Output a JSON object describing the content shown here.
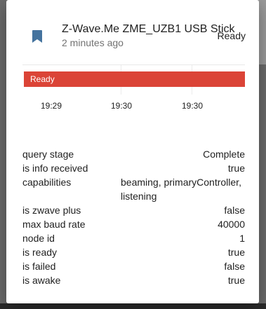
{
  "colors": {
    "accent": "#44739e",
    "state_bar": "#db4437"
  },
  "header": {
    "icon": "bookmark-icon",
    "entity_name": "Z-Wave.Me ZME_UZB1 USB Stick",
    "last_changed": "2 minutes ago",
    "state": "Ready"
  },
  "timeline": {
    "bar_label": "Ready",
    "ticks": [
      "19:29",
      "19:30",
      "19:30"
    ]
  },
  "attributes": [
    {
      "key": "query stage",
      "value": "Complete"
    },
    {
      "key": "is info received",
      "value": "true"
    },
    {
      "key": "capabilities",
      "value": "beaming, primaryController, listening"
    },
    {
      "key": "is zwave plus",
      "value": "false"
    },
    {
      "key": "max baud rate",
      "value": "40000"
    },
    {
      "key": "node id",
      "value": "1"
    },
    {
      "key": "is ready",
      "value": "true"
    },
    {
      "key": "is failed",
      "value": "false"
    },
    {
      "key": "is awake",
      "value": "true"
    }
  ]
}
